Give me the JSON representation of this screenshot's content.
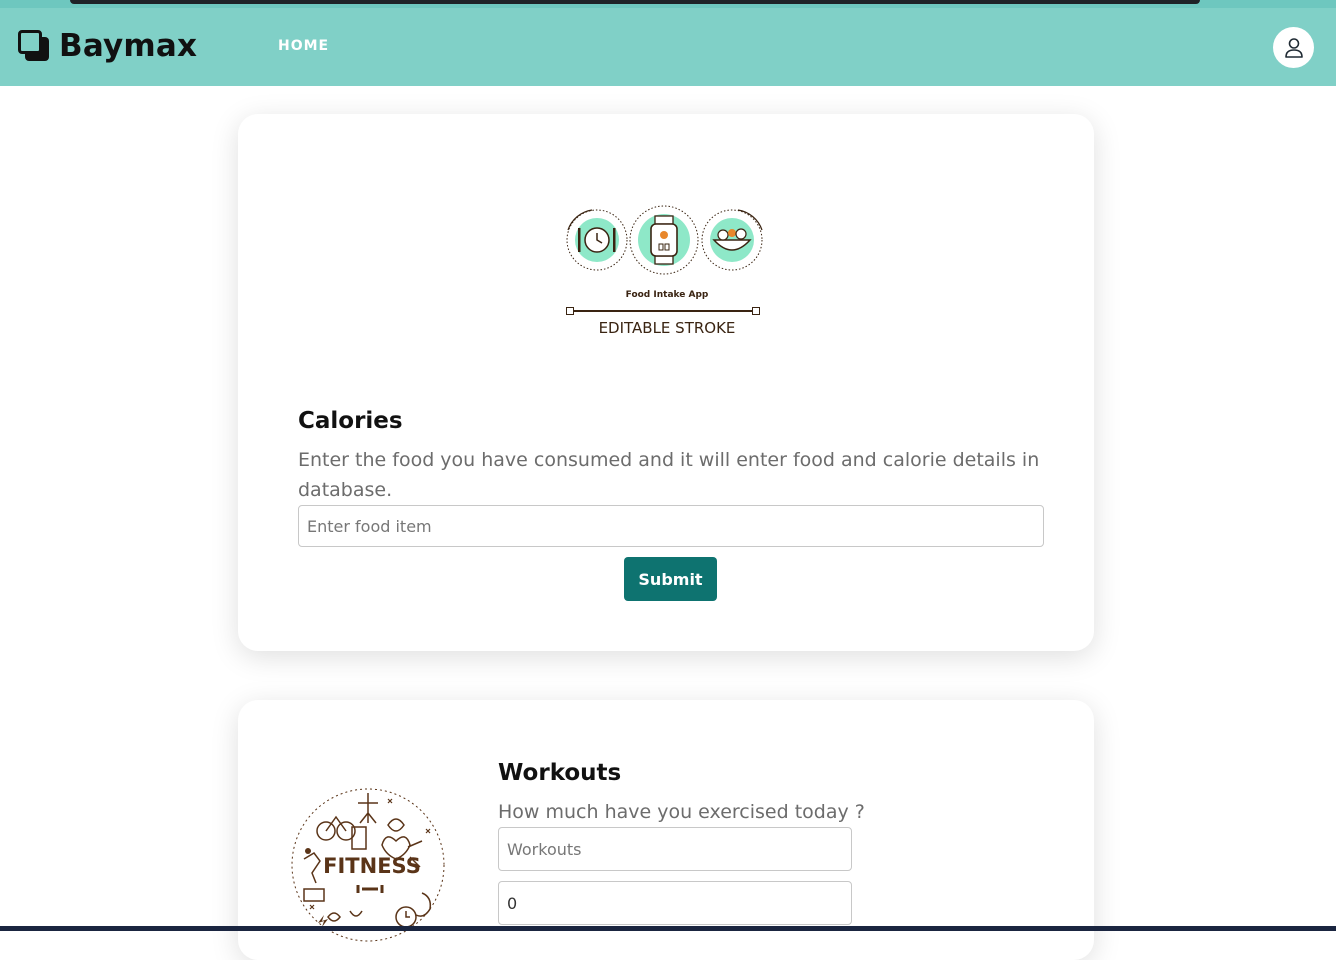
{
  "header": {
    "brand_name": "Baymax",
    "nav": [
      {
        "label": "HOME"
      }
    ],
    "profile_icon": "user-icon"
  },
  "calories_card": {
    "illustration": {
      "caption": "Food Intake App",
      "subcaption": "EDITABLE STROKE",
      "icons": [
        "plate-clock-icon",
        "smartwatch-icon",
        "salad-bowl-icon"
      ]
    },
    "title": "Calories",
    "description": "Enter the food you have consumed and it will enter food and calorie details in database.",
    "food_input": {
      "placeholder": "Enter food item",
      "value": ""
    },
    "submit_label": "Submit"
  },
  "workouts_card": {
    "illustration": {
      "label": "FITNESS"
    },
    "title": "Workouts",
    "description": "How much have you exercised today ?",
    "workout_input": {
      "placeholder": "Workouts",
      "value": ""
    },
    "amount_input": {
      "value": "0"
    }
  },
  "colors": {
    "navbar": "#80d0c7",
    "accent": "#0e7370",
    "illustration_mint": "#8ee8c8",
    "illustration_brown": "#3a2412"
  }
}
